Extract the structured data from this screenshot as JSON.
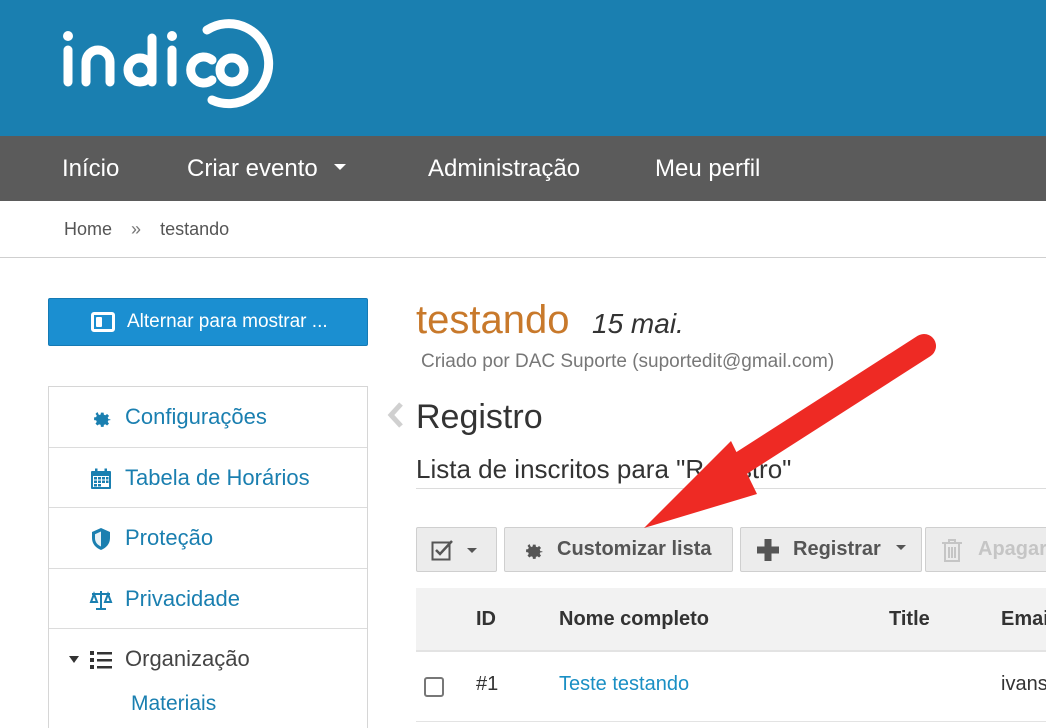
{
  "brand": {
    "logo_text": "indico"
  },
  "nav": {
    "items": [
      {
        "label": "Início"
      },
      {
        "label": "Criar evento"
      },
      {
        "label": "Administração"
      },
      {
        "label": "Meu perfil"
      }
    ]
  },
  "breadcrumb": {
    "home": "Home",
    "separator": "»",
    "current": "testando"
  },
  "sidebar": {
    "toggle_label": "Alternar para mostrar ...",
    "items": [
      {
        "label": "Configurações",
        "icon": "gear-icon"
      },
      {
        "label": "Tabela de Horários",
        "icon": "calendar-icon"
      },
      {
        "label": "Proteção",
        "icon": "shield-icon"
      },
      {
        "label": "Privacidade",
        "icon": "scales-icon"
      },
      {
        "label": "Organização",
        "icon": "list-icon"
      }
    ],
    "subitems": [
      {
        "label": "Materiais"
      }
    ]
  },
  "event": {
    "title": "testando",
    "date": "15 mai.",
    "created_by": "Criado por DAC Suporte (suportedit@gmail.com)"
  },
  "page": {
    "section_title": "Registro",
    "subtitle": "Lista de inscritos para \"Registro\""
  },
  "toolbar": {
    "customize_label": "Customizar lista",
    "register_label": "Registrar",
    "delete_label": "Apagar"
  },
  "table": {
    "headers": {
      "id": "ID",
      "name": "Nome completo",
      "title": "Title",
      "email": "Email"
    },
    "rows": [
      {
        "id": "#1",
        "name": "Teste testando",
        "email": "ivans"
      }
    ]
  },
  "colors": {
    "header": "#1a7fb0",
    "navbar": "#5b5b5b",
    "accent": "#1b8fd1",
    "event_title": "#c8792b",
    "annotation_arrow": "#ee2a24"
  }
}
